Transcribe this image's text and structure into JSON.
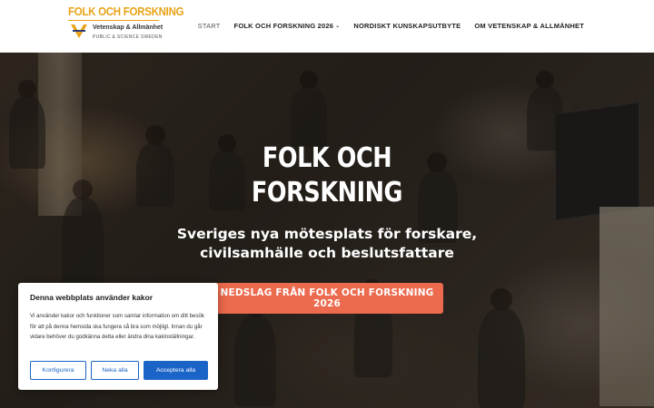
{
  "colors": {
    "accent": "#ec6a4e",
    "brand_gold": "#e8a317",
    "cookie_blue": "#1a64c8"
  },
  "logo": {
    "title": "FOLK OCH FORSKNING",
    "subtitle": "Vetenskap & Allmänhet",
    "tagline": "PUBLIC & SCIENCE SWEDEN",
    "mark_icon": "va-logo-icon"
  },
  "nav": {
    "items": [
      {
        "label": "START",
        "active": true,
        "has_dropdown": false
      },
      {
        "label": "FOLK OCH FORSKNING 2026",
        "active": false,
        "has_dropdown": true
      },
      {
        "label": "NORDISKT KUNSKAPSUTBYTE",
        "active": false,
        "has_dropdown": false
      },
      {
        "label": "OM VETENSKAP & ALLMÄNHET",
        "active": false,
        "has_dropdown": false
      }
    ],
    "dropdown_icon": "chevron-down-icon"
  },
  "hero": {
    "title_line1": "FOLK OCH",
    "title_line2": "FORSKNING",
    "subtitle_line1": "Sveriges nya mötesplats för forskare,",
    "subtitle_line2": "civilsamhälle och beslutsfattare",
    "button_label": "NEDSLAG FRÅN FOLK OCH FORSKNING 2026"
  },
  "cookie": {
    "title": "Denna webbplats använder kakor",
    "text": "Vi använder kakor och funktioner som samlar information om ditt besök för att på denna hemsida ska fungera så bra som möjligt. Innan du går vidare behöver du godkänna detta eller ändra dina kakinställningar.",
    "configure_label": "Konfigurera",
    "reject_label": "Neka alla",
    "accept_label": "Acceptera alla"
  }
}
